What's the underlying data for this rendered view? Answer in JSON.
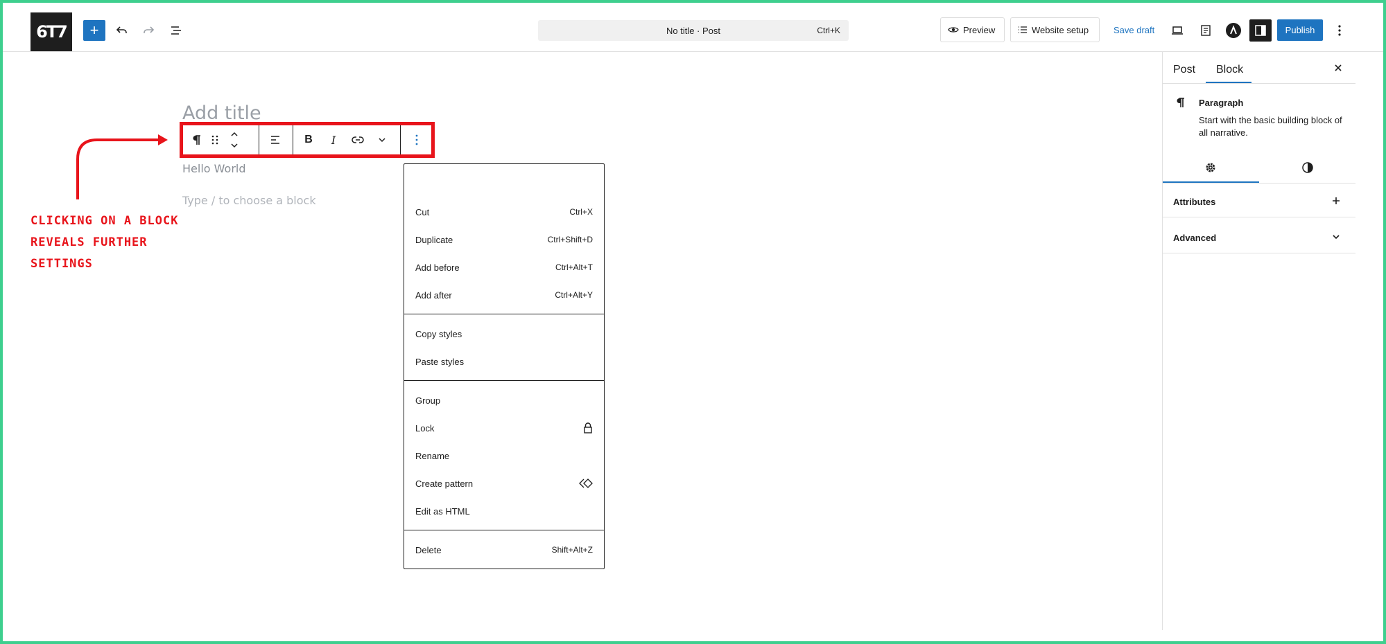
{
  "header": {
    "logo_text": "6T7",
    "command_title": "No title · Post",
    "command_shortcut": "Ctrl+K",
    "preview_label": "Preview",
    "website_setup_label": "Website setup",
    "save_draft_label": "Save draft",
    "publish_label": "Publish"
  },
  "editor": {
    "title_placeholder": "Add title",
    "paragraph_text": "Hello World",
    "block_placeholder": "Type / to choose a block"
  },
  "annotation": {
    "lines": [
      "Clicking on a block",
      "reveals further",
      "settings"
    ],
    "color": "#e8141b"
  },
  "menu": {
    "items": [
      {
        "label": "Cut",
        "shortcut": "Ctrl+X"
      },
      {
        "label": "Duplicate",
        "shortcut": "Ctrl+Shift+D"
      },
      {
        "label": "Add before",
        "shortcut": "Ctrl+Alt+T"
      },
      {
        "label": "Add after",
        "shortcut": "Ctrl+Alt+Y"
      },
      {
        "label": "Copy styles",
        "shortcut": ""
      },
      {
        "label": "Paste styles",
        "shortcut": ""
      },
      {
        "label": "Group",
        "shortcut": ""
      },
      {
        "label": "Lock",
        "shortcut": "",
        "icon": "lock-icon"
      },
      {
        "label": "Rename",
        "shortcut": ""
      },
      {
        "label": "Create pattern",
        "shortcut": "",
        "icon": "pattern-icon"
      },
      {
        "label": "Edit as HTML",
        "shortcut": ""
      },
      {
        "label": "Delete",
        "shortcut": "Shift+Alt+Z"
      }
    ]
  },
  "sidebar": {
    "tabs": [
      "Post",
      "Block"
    ],
    "active_tab": "Block",
    "block_name": "Paragraph",
    "block_description": "Start with the basic building block of all narrative.",
    "sections": [
      "Attributes",
      "Advanced"
    ]
  },
  "colors": {
    "accent": "#1e74c0",
    "frame": "#3ecf8e",
    "highlight": "#e8141b"
  }
}
